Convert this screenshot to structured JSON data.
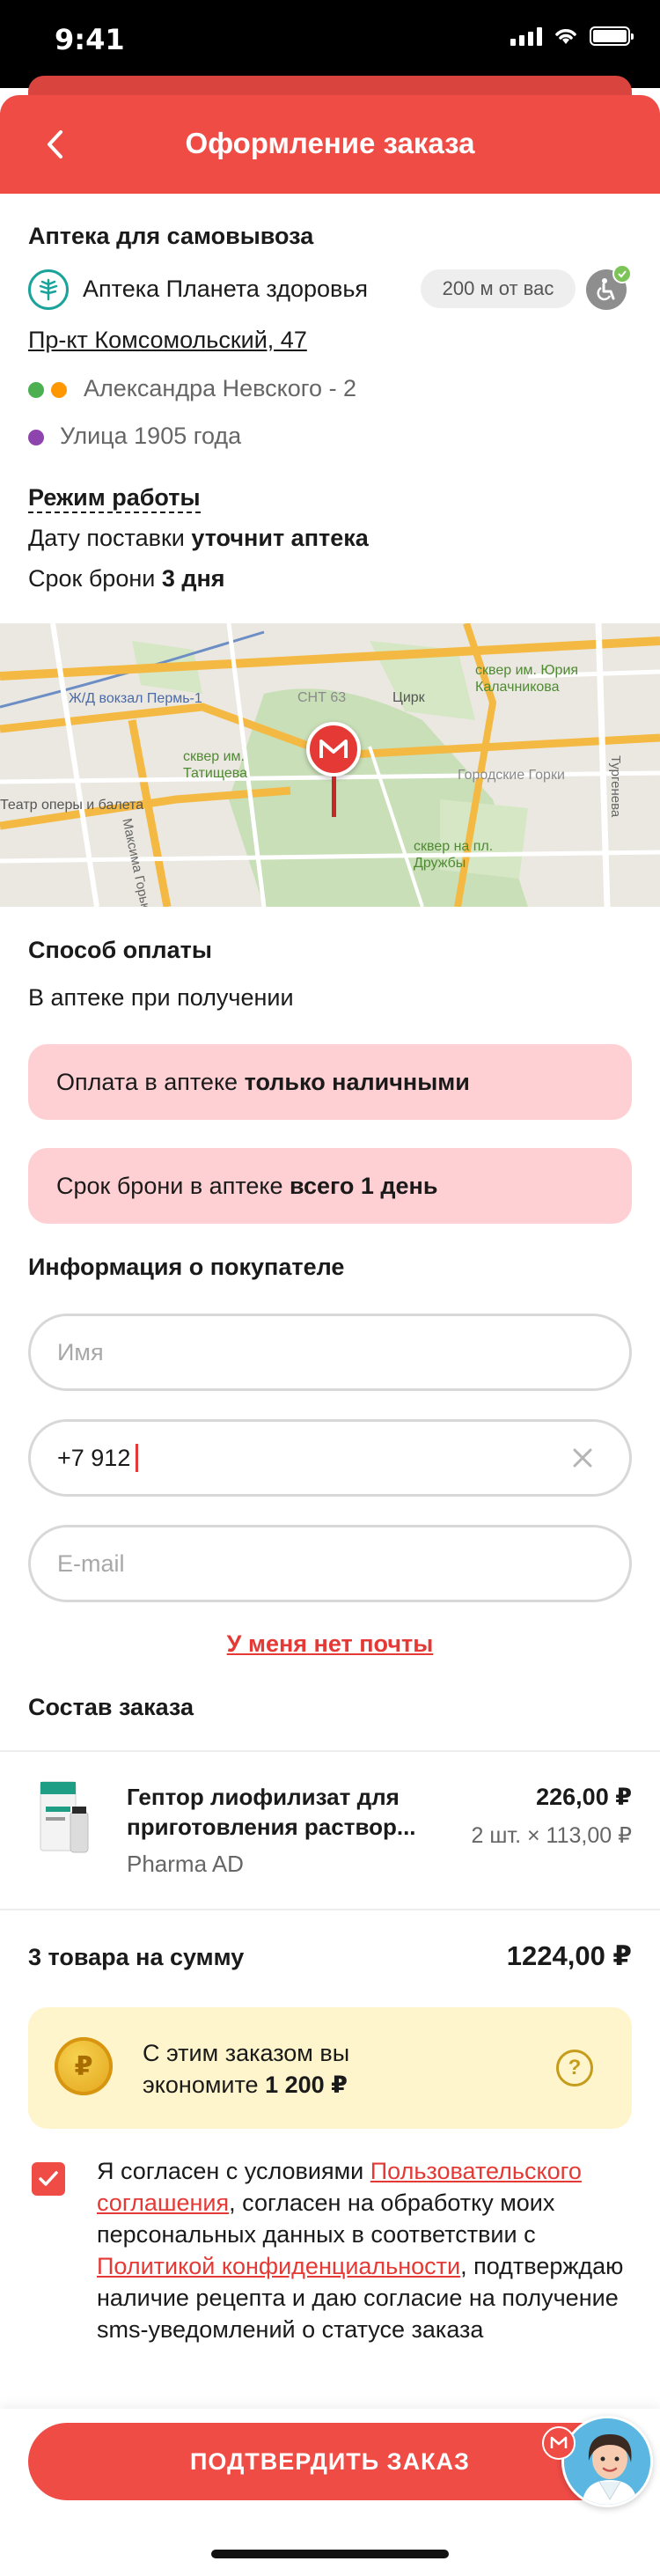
{
  "status_bar": {
    "time": "9:41"
  },
  "header": {
    "title": "Оформление заказа"
  },
  "pickup": {
    "section_title": "Аптека для самовывоза",
    "pharmacy_name": "Аптека Планета здоровья",
    "distance": "200 м от вас",
    "address": "Пр-кт Комсомольский, 47",
    "metro": [
      {
        "name": "Александра Невского - 2",
        "colors": [
          "#4caf50",
          "#ff9800"
        ]
      },
      {
        "name": "Улица 1905 года",
        "colors": [
          "#8e44ad"
        ]
      }
    ],
    "work_hours_label": "Режим работы",
    "delivery_date_prefix": "Дату поставки ",
    "delivery_date_value": "уточнит аптека",
    "reserve_prefix": "Срок брони ",
    "reserve_value": "3 дня"
  },
  "map": {
    "labels": {
      "station": "Ж/Д вокзал Пермь-1",
      "snt": "СНТ 63",
      "circus": "Цирк",
      "square_gagarin": "сквер им. Юрия Калачникова",
      "square_tatishchev": "сквер им. Татищева",
      "gorodskie_gorki": "Городские Горки",
      "opera": "Театр оперы и балета",
      "maxim_gorky": "Максима Горького",
      "turgeneva": "Тургенева",
      "square_druzhby": "сквер на пл. Дружбы"
    }
  },
  "payment": {
    "section_title": "Способ оплаты",
    "method": "В аптеке при получении",
    "notice_1_prefix": "Оплата в аптеке ",
    "notice_1_bold": "только наличными",
    "notice_2_prefix": "Срок брони в аптеке ",
    "notice_2_bold": "всего 1 день"
  },
  "buyer": {
    "section_title": "Информация о покупателе",
    "name_placeholder": "Имя",
    "phone_value": "+7 912",
    "email_placeholder": "E-mail",
    "no_email_link": "У меня нет почты"
  },
  "order": {
    "section_title": "Состав заказа",
    "items": [
      {
        "name_line1": "Гептор лиофилизат для",
        "name_line2": "приготовления раствор...",
        "manufacturer": "Pharma AD",
        "total": "226,00 ₽",
        "qty_price": "2 шт. × 113,00 ₽"
      }
    ],
    "summary_label": "3 товара на сумму",
    "summary_total": "1224,00 ₽"
  },
  "savings": {
    "line1": "С этим заказом вы",
    "line2_prefix": "экономите ",
    "line2_bold": "1 200 ₽",
    "coin_symbol": "₽",
    "help_symbol": "?"
  },
  "consent": {
    "part1": "Я согласен с условиями ",
    "link1": "Пользовательского соглашения",
    "part2": ", согласен на обработку моих персональных данных в соответствии с ",
    "link2": "Политикой конфиденциальности",
    "part3": ", подтверждаю наличие рецепта и даю согласие на получение sms-уведомлений о статусе заказа",
    "checked": true
  },
  "cta": {
    "confirm_label": "ПОДТВЕРДИТЬ ЗАКАЗ"
  },
  "colors": {
    "brand_red": "#f04c46",
    "link_red": "#e53935",
    "notice_bg": "#ffd0d3",
    "savings_bg": "#fff5cc"
  }
}
